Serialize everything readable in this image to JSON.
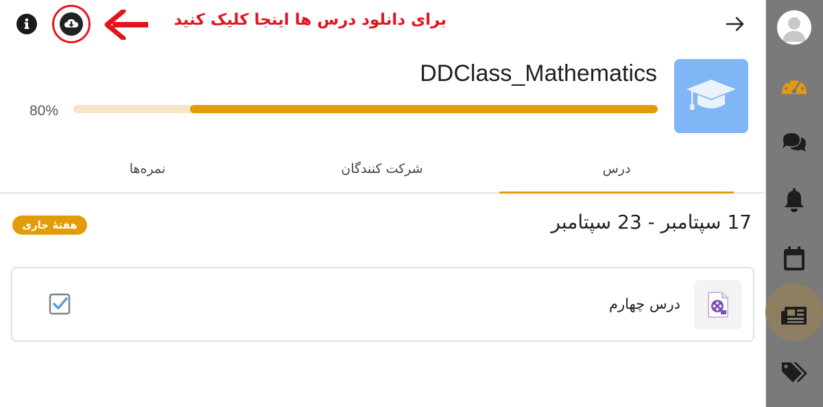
{
  "header": {
    "annotation_text": "برای دانلود درس ها اینجا کلیک کنید",
    "info_icon": "info-icon",
    "download_icon": "cloud-download-icon",
    "back_icon": "arrow-right-icon",
    "annotation_color": "#e4141c"
  },
  "course": {
    "title": "DDClass_Mathematics",
    "image_icon": "graduation-cap-icon",
    "image_color": "#7fb6f5",
    "progress_label": "80%",
    "progress_value": 0.8,
    "accent_color": "#e39b0c"
  },
  "tabs": [
    {
      "label": "درس",
      "active": true
    },
    {
      "label": "شرکت کنندگان",
      "active": false
    },
    {
      "label": "نمره‌ها",
      "active": false
    }
  ],
  "week": {
    "title": "17 سپتامبر - 23 سپتامبر",
    "badge": "هفتهٔ جاری"
  },
  "activities": [
    {
      "name": "درس چهارم",
      "icon": "video-file-icon",
      "completed": true
    }
  ],
  "sidebar": {
    "items": [
      {
        "name": "avatar",
        "icon": "user-avatar-icon"
      },
      {
        "name": "dashboard",
        "icon": "gauge-icon"
      },
      {
        "name": "messages",
        "icon": "chat-bubbles-icon"
      },
      {
        "name": "notifications",
        "icon": "bell-icon"
      },
      {
        "name": "calendar",
        "icon": "calendar-icon"
      },
      {
        "name": "courses",
        "icon": "newspaper-icon",
        "active": true
      },
      {
        "name": "tags",
        "icon": "tags-icon"
      }
    ]
  }
}
